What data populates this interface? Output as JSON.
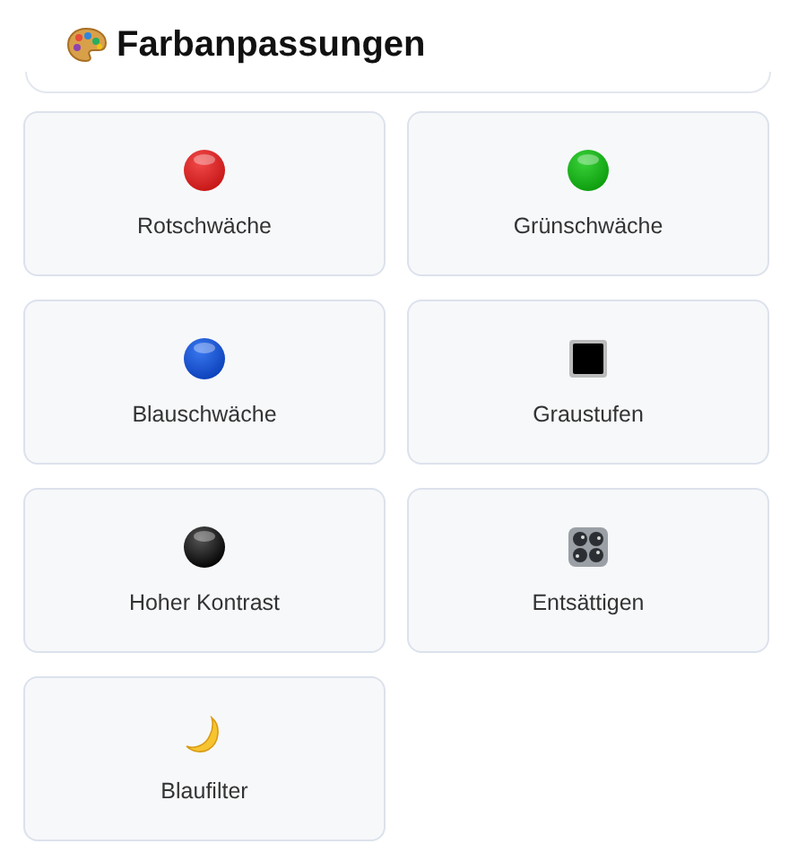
{
  "title": {
    "text": "Farbanpassungen"
  },
  "options": [
    {
      "label": "Rotschwäche"
    },
    {
      "label": "Grünschwäche"
    },
    {
      "label": "Blauschwäche"
    },
    {
      "label": "Graustufen"
    },
    {
      "label": "Hoher Kontrast"
    },
    {
      "label": "Entsättigen"
    },
    {
      "label": "Blaufilter"
    }
  ]
}
